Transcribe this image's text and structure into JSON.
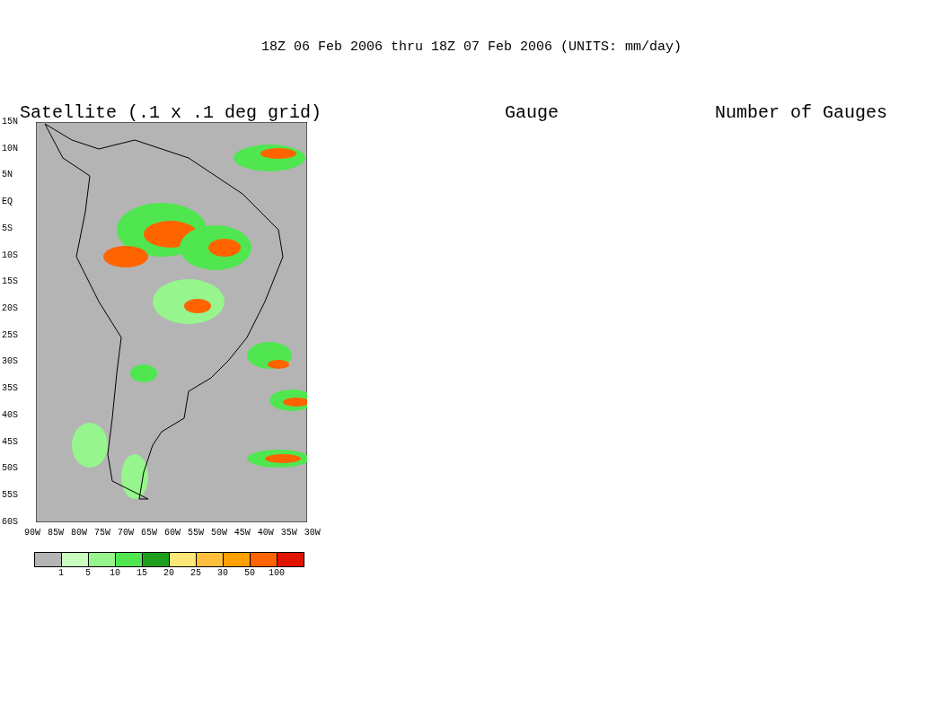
{
  "title": "18Z 06 Feb 2006 thru 18Z 07 Feb 2006 (UNITS: mm/day)",
  "panels": [
    {
      "title": "Satellite (.1 x .1 deg grid)",
      "kind": "map"
    },
    {
      "title": "Gauge",
      "kind": "empty"
    },
    {
      "title": "Number of Gauges",
      "kind": "empty"
    }
  ],
  "y_labels": [
    "15N",
    "10N",
    "5N",
    "EQ",
    "5S",
    "10S",
    "15S",
    "20S",
    "25S",
    "30S",
    "35S",
    "40S",
    "45S",
    "50S",
    "55S",
    "60S"
  ],
  "x_labels": [
    "90W",
    "85W",
    "80W",
    "75W",
    "70W",
    "65W",
    "60W",
    "55W",
    "50W",
    "45W",
    "40W",
    "35W",
    "30W"
  ],
  "legend": {
    "swatches": [
      {
        "color": "#b4b4b4"
      },
      {
        "color": "#c8ffbe"
      },
      {
        "color": "#96f58c"
      },
      {
        "color": "#50e650"
      },
      {
        "color": "#1ea01e"
      },
      {
        "color": "#ffe678"
      },
      {
        "color": "#ffbe3c"
      },
      {
        "color": "#ffa000"
      },
      {
        "color": "#ff6400"
      },
      {
        "color": "#e11400"
      }
    ],
    "labels": [
      "1",
      "5",
      "10",
      "15",
      "20",
      "25",
      "30",
      "50",
      "100"
    ]
  }
}
